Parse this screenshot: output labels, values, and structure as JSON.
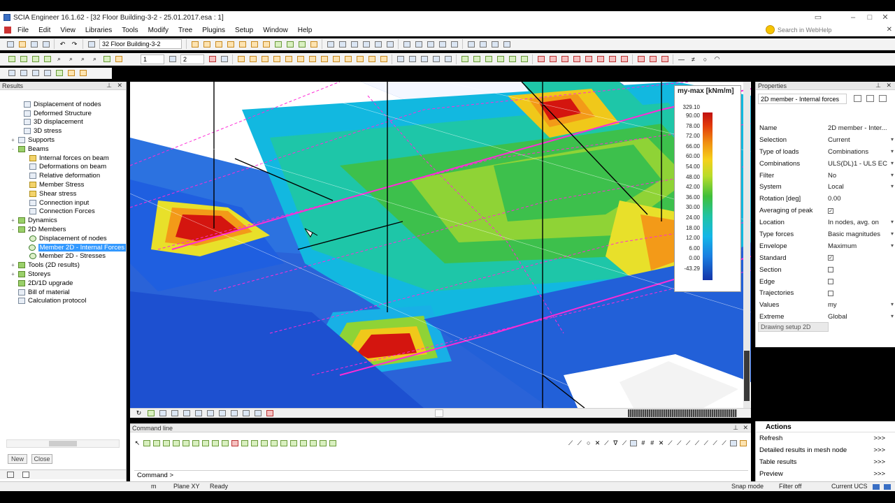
{
  "window": {
    "title": "SCIA Engineer 16.1.62 - [32 Floor Building-3-2 - 25.01.2017.esa : 1]"
  },
  "menu": [
    "File",
    "Edit",
    "View",
    "Libraries",
    "Tools",
    "Modify",
    "Tree",
    "Plugins",
    "Setup",
    "Window",
    "Help"
  ],
  "help_search": {
    "placeholder": "Search in WebHelp"
  },
  "toolbar": {
    "project_combo": "32 Floor Building-3-2",
    "spin1": "1",
    "spin2": "2"
  },
  "results_panel": {
    "title": "Results",
    "tree": [
      {
        "label": "Displacement of nodes",
        "level": 1,
        "expander": "",
        "icon": "deform-icon"
      },
      {
        "label": "Deformed Structure",
        "level": 1,
        "expander": "",
        "icon": "deform-icon"
      },
      {
        "label": "3D displacement",
        "level": 1,
        "expander": "",
        "icon": "displacement-icon"
      },
      {
        "label": "3D stress",
        "level": 1,
        "expander": "",
        "icon": "stress-icon"
      },
      {
        "label": "Supports",
        "level": 0,
        "expander": "+",
        "icon": "support-icon"
      },
      {
        "label": "Beams",
        "level": 0,
        "expander": "-",
        "icon": "beam-icon"
      },
      {
        "label": "Internal forces on beam",
        "level": 2,
        "expander": "",
        "icon": "beam-force-icon"
      },
      {
        "label": "Deformations on beam",
        "level": 2,
        "expander": "",
        "icon": "beam-deform-icon"
      },
      {
        "label": "Relative deformation",
        "level": 2,
        "expander": "",
        "icon": "rel-deform-icon"
      },
      {
        "label": "Member Stress",
        "level": 2,
        "expander": "",
        "icon": "member-stress-icon"
      },
      {
        "label": "Shear stress",
        "level": 2,
        "expander": "",
        "icon": "shear-icon"
      },
      {
        "label": "Connection input",
        "level": 2,
        "expander": "",
        "icon": "connection-icon"
      },
      {
        "label": "Connection Forces",
        "level": 2,
        "expander": "",
        "icon": "connection-icon"
      },
      {
        "label": "Dynamics",
        "level": 0,
        "expander": "+",
        "icon": "dynamics-icon"
      },
      {
        "label": "2D Members",
        "level": 0,
        "expander": "-",
        "icon": "slab-icon"
      },
      {
        "label": "Displacement of nodes",
        "level": 2,
        "expander": "",
        "icon": "target-icon"
      },
      {
        "label": "Member 2D - Internal Forces",
        "level": 2,
        "expander": "",
        "icon": "target-icon",
        "selected": true
      },
      {
        "label": "Member 2D - Stresses",
        "level": 2,
        "expander": "",
        "icon": "target-icon"
      },
      {
        "label": "Tools (2D results)",
        "level": 0,
        "expander": "+",
        "icon": "tools-icon"
      },
      {
        "label": "Storeys",
        "level": 0,
        "expander": "+",
        "icon": "storey-icon"
      },
      {
        "label": "2D/1D upgrade",
        "level": 0,
        "expander": "",
        "icon": "upgrade-icon"
      },
      {
        "label": "Bill of material",
        "level": 0,
        "expander": "",
        "icon": "bom-icon"
      },
      {
        "label": "Calculation protocol",
        "level": 0,
        "expander": "",
        "icon": "protocol-icon"
      }
    ],
    "new_label": "New",
    "close_label": "Close"
  },
  "legend": {
    "title": "my-max [kNm/m]",
    "values": [
      "329.10",
      "90.00",
      "78.00",
      "72.00",
      "66.00",
      "60.00",
      "54.00",
      "48.00",
      "42.00",
      "36.00",
      "30.00",
      "24.00",
      "18.00",
      "12.00",
      "6.00",
      "0.00",
      "-43.29"
    ]
  },
  "command_panel": {
    "title": "Command line",
    "prompt": "Command >"
  },
  "properties": {
    "title": "Properties",
    "combo": "2D member - Internal forces",
    "rows": [
      {
        "k": "Name",
        "v": "2D member - Inter...",
        "type": "text"
      },
      {
        "k": "Selection",
        "v": "Current",
        "type": "dd"
      },
      {
        "k": "Type of loads",
        "v": "Combinations",
        "type": "dd"
      },
      {
        "k": "Combinations",
        "v": "ULS(DL)1 - ULS EC",
        "type": "dd"
      },
      {
        "k": "Filter",
        "v": "No",
        "type": "dd"
      },
      {
        "k": "System",
        "v": "Local",
        "type": "dd"
      },
      {
        "k": "Rotation [deg]",
        "v": "0.00",
        "type": "text"
      },
      {
        "k": "Averaging of peak",
        "v": "checked",
        "type": "chk"
      },
      {
        "k": "Location",
        "v": "In nodes, avg. on",
        "type": "dd"
      },
      {
        "k": "Type forces",
        "v": "Basic magnitudes",
        "type": "dd"
      },
      {
        "k": "Envelope",
        "v": "Maximum",
        "type": "dd"
      },
      {
        "k": "Standard",
        "v": "checked",
        "type": "chk"
      },
      {
        "k": "Section",
        "v": "",
        "type": "chk"
      },
      {
        "k": "Edge",
        "v": "",
        "type": "chk"
      },
      {
        "k": "Trajectories",
        "v": "",
        "type": "chk"
      },
      {
        "k": "Values",
        "v": "my",
        "type": "dd"
      },
      {
        "k": "Extreme",
        "v": "Global",
        "type": "dd"
      }
    ],
    "drawing_setup": "Drawing setup 2D"
  },
  "actions": {
    "title": "Actions",
    "items": [
      {
        "label": "Refresh",
        "arrow": ">>>"
      },
      {
        "label": "Detailed results in mesh node",
        "arrow": ">>>"
      },
      {
        "label": "Table results",
        "arrow": ">>>"
      },
      {
        "label": "Preview",
        "arrow": ">>>"
      }
    ]
  },
  "status": {
    "unit": "m",
    "plane": "Plane XY",
    "state": "Ready",
    "snap": "Snap mode",
    "filter": "Filter off",
    "ucs": "Current UCS"
  }
}
